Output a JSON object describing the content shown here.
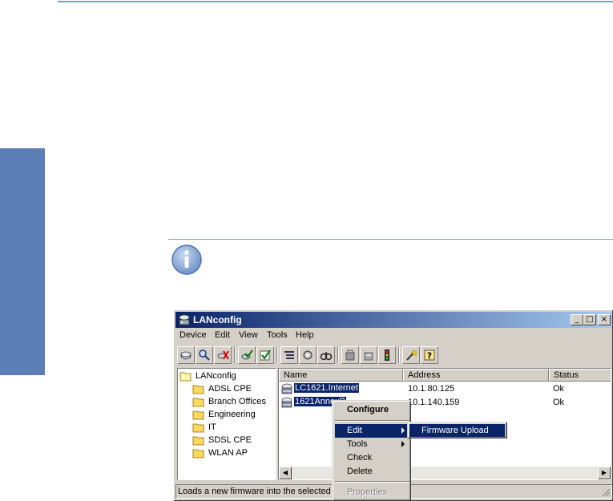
{
  "window": {
    "title": "LANconfig",
    "caption_buttons": {
      "minimize": "_",
      "maximize": "□",
      "close": "×"
    }
  },
  "menubar": [
    "Device",
    "Edit",
    "View",
    "Tools",
    "Help"
  ],
  "toolbar_icons": [
    "device-new-icon",
    "search-device-icon",
    "delete-icon",
    "check-icon",
    "check-all-icon",
    "list-view-icon",
    "configure-icon",
    "monitor-icon",
    "upload-icon",
    "download-icon",
    "traffic-icon",
    "wizard-icon",
    "help-icon"
  ],
  "tree": {
    "root": "LANconfig",
    "folders": [
      "ADSL CPE",
      "Branch Offices",
      "Engineering",
      "IT",
      "SDSL CPE",
      "WLAN AP"
    ]
  },
  "list": {
    "columns": [
      "Name",
      "Address",
      "Status"
    ],
    "rows": [
      {
        "name": "LC1621.Internet",
        "address": "10.1.80.125",
        "status": "Ok"
      },
      {
        "name": "1621AnnexB",
        "address": "10.1.140.159",
        "status": "Ok"
      }
    ]
  },
  "status_text": "Loads a new firmware into the selected d",
  "context_menu": {
    "items": [
      "Configure",
      "Edit",
      "Tools",
      "Check",
      "Delete",
      "Properties"
    ],
    "submenu": "Firmware Upload"
  },
  "colors": {
    "accent": "#5b7fb6",
    "title_start": "#0a246a",
    "title_end": "#a6caf0",
    "selection": "#0a246a"
  }
}
